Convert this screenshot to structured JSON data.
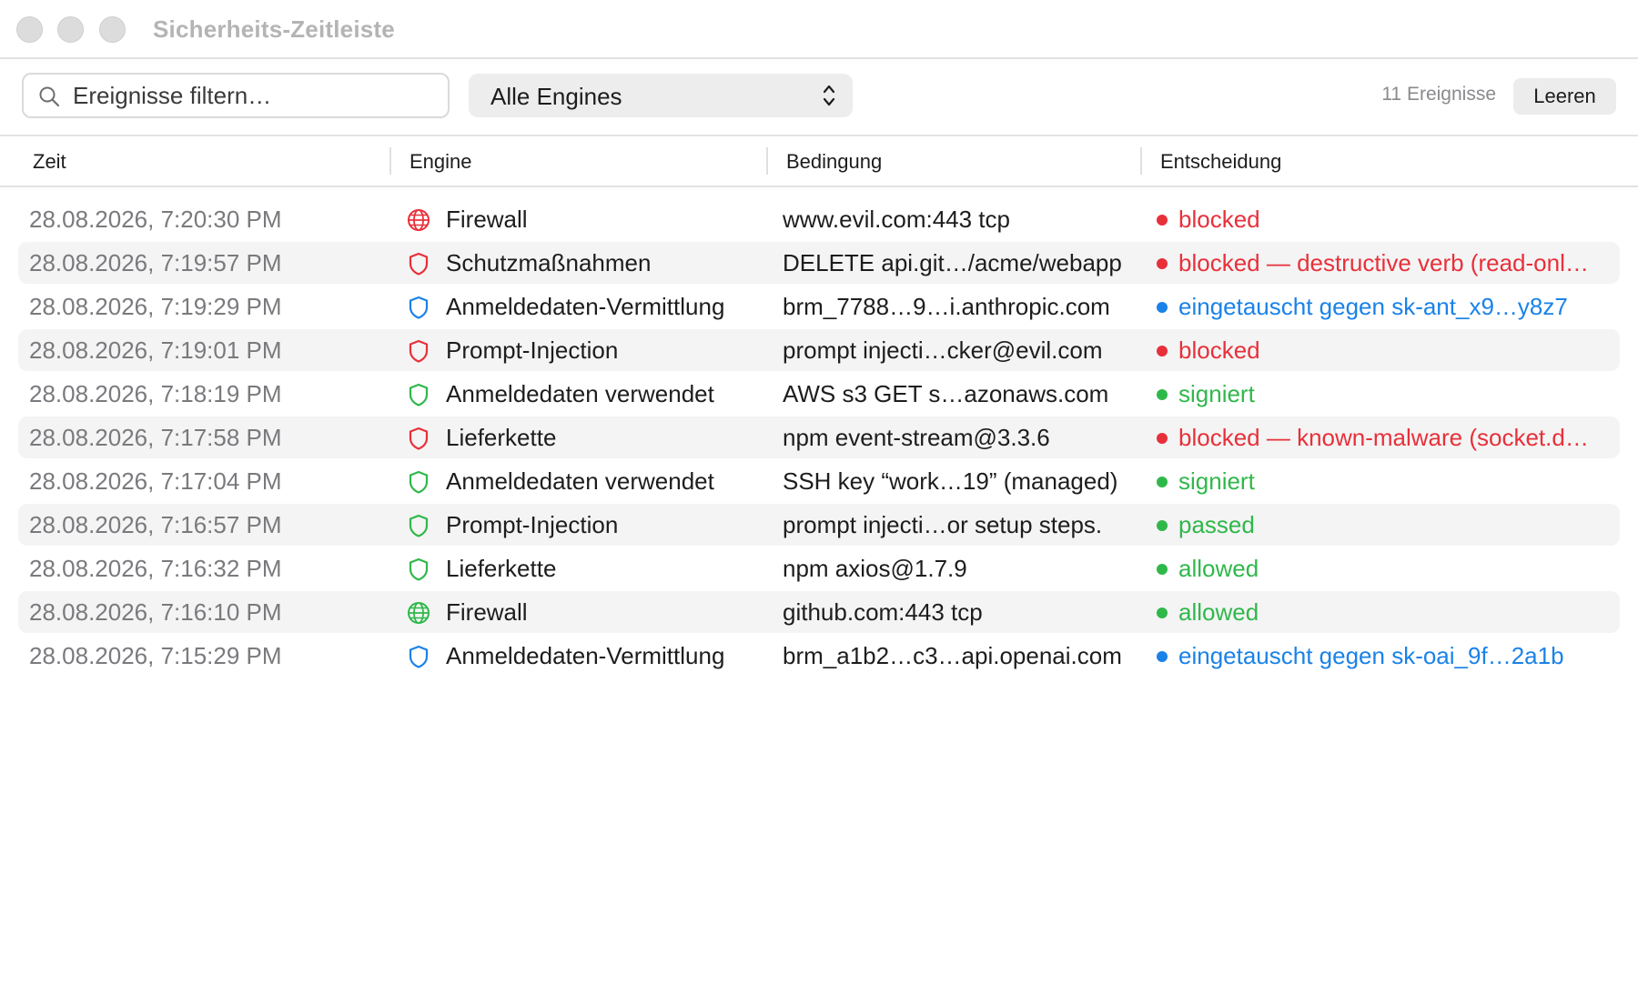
{
  "window": {
    "title": "Sicherheits-Zeitleiste"
  },
  "toolbar": {
    "search_placeholder": "Ereignisse filtern…",
    "engine_select": "Alle Engines",
    "event_count": "11 Ereignisse",
    "clear_label": "Leeren"
  },
  "columns": {
    "time": "Zeit",
    "engine": "Engine",
    "condition": "Bedingung",
    "decision": "Entscheidung"
  },
  "colors": {
    "red": "#e8303a",
    "green": "#2fb84a",
    "blue": "#1a82e8"
  },
  "rows": [
    {
      "time": "28.08.2026, 7:20:30 PM",
      "icon": "globe-icon",
      "engine": "Firewall",
      "condition": "www.evil.com:443 tcp",
      "decision": "blocked",
      "status": "red"
    },
    {
      "time": "28.08.2026, 7:19:57 PM",
      "icon": "shield-icon",
      "engine": "Schutzmaßnahmen",
      "condition": "DELETE api.git…/acme/webapp",
      "decision": "blocked — destructive verb (read-onl…",
      "status": "red"
    },
    {
      "time": "28.08.2026, 7:19:29 PM",
      "icon": "shield-icon",
      "engine": "Anmeldedaten-Vermittlung",
      "condition": "brm_7788…9…i.anthropic.com",
      "decision": "eingetauscht gegen sk-ant_x9…y8z7",
      "status": "blue"
    },
    {
      "time": "28.08.2026, 7:19:01 PM",
      "icon": "shield-icon",
      "engine": "Prompt-Injection",
      "condition": "prompt injecti…cker@evil.com",
      "decision": "blocked",
      "status": "red"
    },
    {
      "time": "28.08.2026, 7:18:19 PM",
      "icon": "shield-icon",
      "engine": "Anmeldedaten verwendet",
      "condition": "AWS s3 GET s…azonaws.com",
      "decision": "signiert",
      "status": "green"
    },
    {
      "time": "28.08.2026, 7:17:58 PM",
      "icon": "shield-icon",
      "engine": "Lieferkette",
      "condition": "npm event-stream@3.3.6",
      "decision": "blocked — known-malware (socket.d…",
      "status": "red"
    },
    {
      "time": "28.08.2026, 7:17:04 PM",
      "icon": "shield-icon",
      "engine": "Anmeldedaten verwendet",
      "condition": "SSH key “work…19” (managed)",
      "decision": "signiert",
      "status": "green"
    },
    {
      "time": "28.08.2026, 7:16:57 PM",
      "icon": "shield-icon",
      "engine": "Prompt-Injection",
      "condition": "prompt injecti…or setup steps.",
      "decision": "passed",
      "status": "green"
    },
    {
      "time": "28.08.2026, 7:16:32 PM",
      "icon": "shield-icon",
      "engine": "Lieferkette",
      "condition": "npm axios@1.7.9",
      "decision": "allowed",
      "status": "green"
    },
    {
      "time": "28.08.2026, 7:16:10 PM",
      "icon": "globe-icon",
      "engine": "Firewall",
      "condition": "github.com:443 tcp",
      "decision": "allowed",
      "status": "green"
    },
    {
      "time": "28.08.2026, 7:15:29 PM",
      "icon": "shield-icon",
      "engine": "Anmeldedaten-Vermittlung",
      "condition": "brm_a1b2…c3…api.openai.com",
      "decision": "eingetauscht gegen sk-oai_9f…2a1b",
      "status": "blue"
    }
  ]
}
